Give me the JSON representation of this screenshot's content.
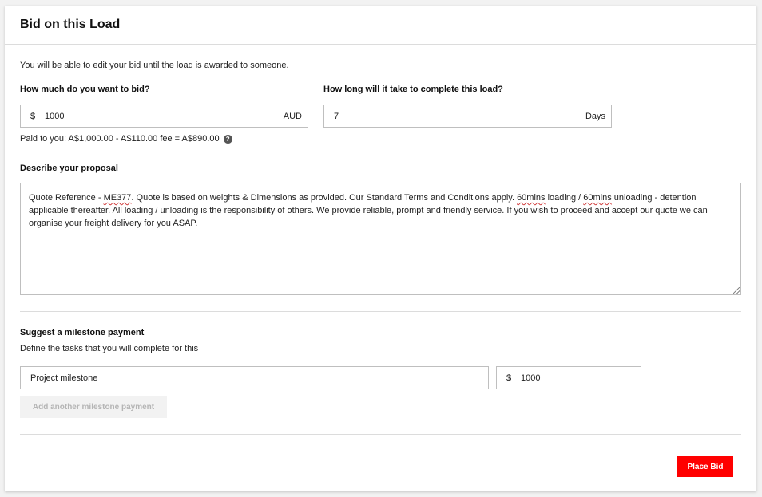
{
  "dialog": {
    "title": "Bid on this Load"
  },
  "intro_text": "You will be able to edit your bid until the load is awarded to someone.",
  "bid": {
    "label": "How much do you want to bid?",
    "currency_symbol": "$",
    "amount": "1000",
    "currency_code": "AUD",
    "paid_text": "Paid to you: A$1,000.00 - A$110.00 fee = A$890.00",
    "help_glyph": "?"
  },
  "duration": {
    "label": "How long will it take to complete this load?",
    "value": "7",
    "unit": "Days"
  },
  "proposal": {
    "label": "Describe your proposal",
    "text_parts": {
      "p1": "Quote Reference - ",
      "ref": "ME377",
      "p2": ". Quote is based on weights & Dimensions as provided. Our Standard Terms and Conditions apply. ",
      "w1": "60mins",
      "p3": " loading / ",
      "w2": "60mins",
      "p4": " unloading - detention applicable thereafter. All loading / unloading is the responsibility of others. We provide reliable, prompt and  friendly service. If you wish to proceed and accept our quote we can organise your freight delivery for you ASAP."
    }
  },
  "milestone": {
    "heading": "Suggest a milestone payment",
    "description": "Define the tasks that you will complete for this",
    "name_value": "Project milestone",
    "currency_symbol": "$",
    "amount": "1000",
    "add_label": "Add another milestone payment"
  },
  "actions": {
    "place_bid_label": "Place Bid"
  },
  "colors": {
    "primary": "#ff0000",
    "border": "#bfbfbf"
  }
}
